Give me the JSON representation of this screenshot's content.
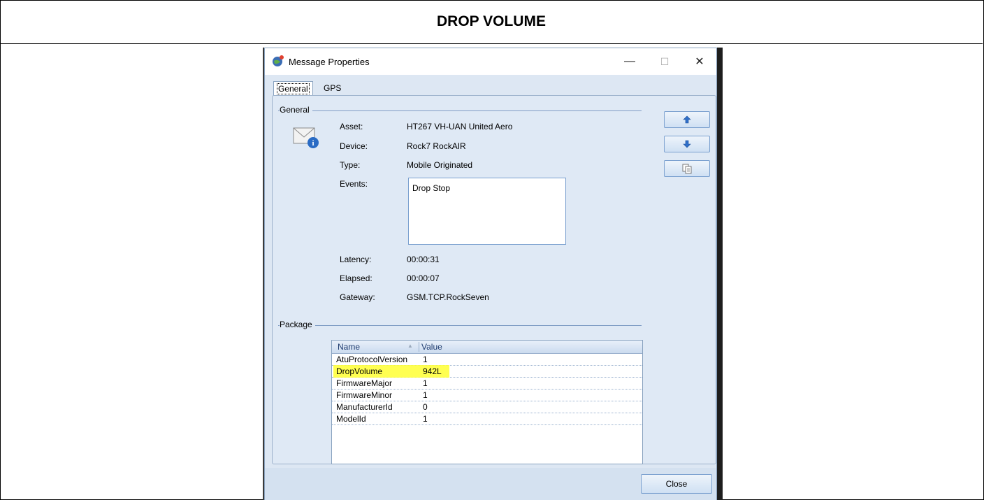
{
  "page": {
    "heading": "DROP VOLUME"
  },
  "window": {
    "title": "Message Properties",
    "minimize_glyph": "—",
    "maximize_glyph": "☐",
    "close_glyph": "✕"
  },
  "tabs": [
    {
      "label": "General",
      "active": true
    },
    {
      "label": "GPS",
      "active": false
    }
  ],
  "general": {
    "group_label": "General",
    "icon": "message-info-icon",
    "properties": [
      {
        "label": "Asset:",
        "value": "HT267 VH-UAN United Aero"
      },
      {
        "label": "Device:",
        "value": "Rock7 RockAIR"
      },
      {
        "label": "Type:",
        "value": "Mobile Originated"
      },
      {
        "label": "Events:",
        "value": ""
      }
    ],
    "events": [
      "Drop Stop"
    ],
    "timing": [
      {
        "label": "Latency:",
        "value": "00:00:31"
      },
      {
        "label": "Elapsed:",
        "value": "00:00:07"
      },
      {
        "label": "Gateway:",
        "value": "GSM.TCP.RockSeven"
      }
    ]
  },
  "side_buttons": [
    {
      "icon": "arrow-up-icon"
    },
    {
      "icon": "arrow-down-icon"
    },
    {
      "icon": "copy-icon"
    }
  ],
  "package": {
    "group_label": "Package",
    "columns": [
      "Name",
      "Value"
    ],
    "rows": [
      {
        "name": "AtuProtocolVersion",
        "value": "1"
      },
      {
        "name": "DropVolume",
        "value": "942L",
        "highlighted": true
      },
      {
        "name": "FirmwareMajor",
        "value": "1"
      },
      {
        "name": "FirmwareMinor",
        "value": "1"
      },
      {
        "name": "ManufacturerId",
        "value": "0"
      },
      {
        "name": "ModelId",
        "value": "1"
      }
    ]
  },
  "footer": {
    "close_label": "Close"
  },
  "colors": {
    "highlight": "#ffff33",
    "accent": "#1e3b6e",
    "dialog_bg": "#dde7f3"
  }
}
